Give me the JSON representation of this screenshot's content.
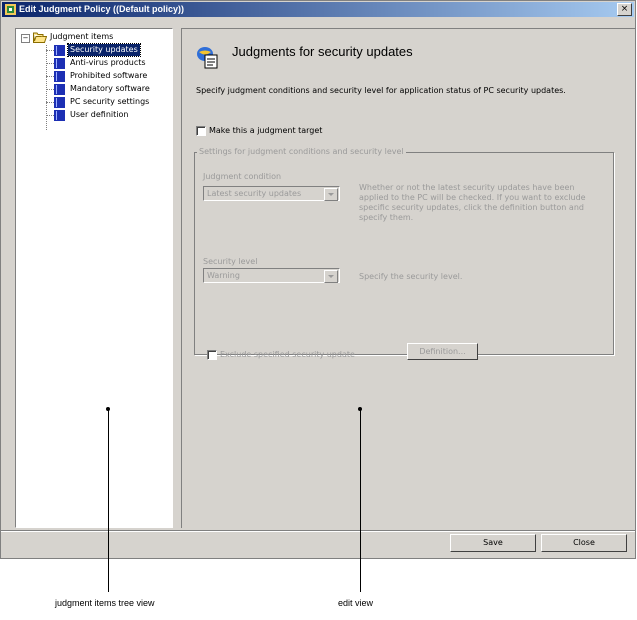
{
  "window": {
    "title": "Edit Judgment Policy ((Default policy))",
    "close_glyph": "×"
  },
  "tree": {
    "expander_glyph": "−",
    "root_label": "Judgment items",
    "items": [
      {
        "label": "Security updates",
        "selected": true
      },
      {
        "label": "Anti-virus products"
      },
      {
        "label": "Prohibited software"
      },
      {
        "label": "Mandatory software"
      },
      {
        "label": "PC security settings"
      },
      {
        "label": "User definition"
      }
    ]
  },
  "edit": {
    "title": "Judgments for security updates",
    "description": "Specify judgment conditions and security level for application status of PC security updates.",
    "target_checkbox_label": "Make this a judgment target",
    "target_checked": false,
    "group_title": "Settings for judgment conditions and security level",
    "condition_label": "Judgment condition",
    "condition_value": "Latest security updates",
    "condition_desc": "Whether or not the latest security updates have been applied to the PC will be checked. If you want to exclude specific security updates, click the definition button and specify them.",
    "level_label": "Security level",
    "level_value": "Warning",
    "level_desc": "Specify the security level.",
    "exclude_label": "Exclude specified security update",
    "definition_button": "Definition..."
  },
  "buttons": {
    "save": "Save",
    "close": "Close"
  },
  "annotations": {
    "tree_view": "judgment items tree view",
    "edit_view": "edit view"
  }
}
